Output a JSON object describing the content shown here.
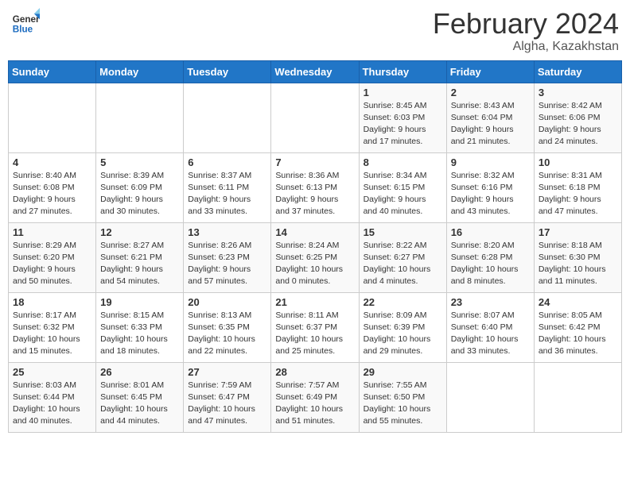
{
  "header": {
    "logo_line1": "General",
    "logo_line2": "Blue",
    "main_title": "February 2024",
    "sub_title": "Algha, Kazakhstan"
  },
  "days_of_week": [
    "Sunday",
    "Monday",
    "Tuesday",
    "Wednesday",
    "Thursday",
    "Friday",
    "Saturday"
  ],
  "weeks": [
    [
      {
        "day": "",
        "info": ""
      },
      {
        "day": "",
        "info": ""
      },
      {
        "day": "",
        "info": ""
      },
      {
        "day": "",
        "info": ""
      },
      {
        "day": "1",
        "info": "Sunrise: 8:45 AM\nSunset: 6:03 PM\nDaylight: 9 hours and 17 minutes."
      },
      {
        "day": "2",
        "info": "Sunrise: 8:43 AM\nSunset: 6:04 PM\nDaylight: 9 hours and 21 minutes."
      },
      {
        "day": "3",
        "info": "Sunrise: 8:42 AM\nSunset: 6:06 PM\nDaylight: 9 hours and 24 minutes."
      }
    ],
    [
      {
        "day": "4",
        "info": "Sunrise: 8:40 AM\nSunset: 6:08 PM\nDaylight: 9 hours and 27 minutes."
      },
      {
        "day": "5",
        "info": "Sunrise: 8:39 AM\nSunset: 6:09 PM\nDaylight: 9 hours and 30 minutes."
      },
      {
        "day": "6",
        "info": "Sunrise: 8:37 AM\nSunset: 6:11 PM\nDaylight: 9 hours and 33 minutes."
      },
      {
        "day": "7",
        "info": "Sunrise: 8:36 AM\nSunset: 6:13 PM\nDaylight: 9 hours and 37 minutes."
      },
      {
        "day": "8",
        "info": "Sunrise: 8:34 AM\nSunset: 6:15 PM\nDaylight: 9 hours and 40 minutes."
      },
      {
        "day": "9",
        "info": "Sunrise: 8:32 AM\nSunset: 6:16 PM\nDaylight: 9 hours and 43 minutes."
      },
      {
        "day": "10",
        "info": "Sunrise: 8:31 AM\nSunset: 6:18 PM\nDaylight: 9 hours and 47 minutes."
      }
    ],
    [
      {
        "day": "11",
        "info": "Sunrise: 8:29 AM\nSunset: 6:20 PM\nDaylight: 9 hours and 50 minutes."
      },
      {
        "day": "12",
        "info": "Sunrise: 8:27 AM\nSunset: 6:21 PM\nDaylight: 9 hours and 54 minutes."
      },
      {
        "day": "13",
        "info": "Sunrise: 8:26 AM\nSunset: 6:23 PM\nDaylight: 9 hours and 57 minutes."
      },
      {
        "day": "14",
        "info": "Sunrise: 8:24 AM\nSunset: 6:25 PM\nDaylight: 10 hours and 0 minutes."
      },
      {
        "day": "15",
        "info": "Sunrise: 8:22 AM\nSunset: 6:27 PM\nDaylight: 10 hours and 4 minutes."
      },
      {
        "day": "16",
        "info": "Sunrise: 8:20 AM\nSunset: 6:28 PM\nDaylight: 10 hours and 8 minutes."
      },
      {
        "day": "17",
        "info": "Sunrise: 8:18 AM\nSunset: 6:30 PM\nDaylight: 10 hours and 11 minutes."
      }
    ],
    [
      {
        "day": "18",
        "info": "Sunrise: 8:17 AM\nSunset: 6:32 PM\nDaylight: 10 hours and 15 minutes."
      },
      {
        "day": "19",
        "info": "Sunrise: 8:15 AM\nSunset: 6:33 PM\nDaylight: 10 hours and 18 minutes."
      },
      {
        "day": "20",
        "info": "Sunrise: 8:13 AM\nSunset: 6:35 PM\nDaylight: 10 hours and 22 minutes."
      },
      {
        "day": "21",
        "info": "Sunrise: 8:11 AM\nSunset: 6:37 PM\nDaylight: 10 hours and 25 minutes."
      },
      {
        "day": "22",
        "info": "Sunrise: 8:09 AM\nSunset: 6:39 PM\nDaylight: 10 hours and 29 minutes."
      },
      {
        "day": "23",
        "info": "Sunrise: 8:07 AM\nSunset: 6:40 PM\nDaylight: 10 hours and 33 minutes."
      },
      {
        "day": "24",
        "info": "Sunrise: 8:05 AM\nSunset: 6:42 PM\nDaylight: 10 hours and 36 minutes."
      }
    ],
    [
      {
        "day": "25",
        "info": "Sunrise: 8:03 AM\nSunset: 6:44 PM\nDaylight: 10 hours and 40 minutes."
      },
      {
        "day": "26",
        "info": "Sunrise: 8:01 AM\nSunset: 6:45 PM\nDaylight: 10 hours and 44 minutes."
      },
      {
        "day": "27",
        "info": "Sunrise: 7:59 AM\nSunset: 6:47 PM\nDaylight: 10 hours and 47 minutes."
      },
      {
        "day": "28",
        "info": "Sunrise: 7:57 AM\nSunset: 6:49 PM\nDaylight: 10 hours and 51 minutes."
      },
      {
        "day": "29",
        "info": "Sunrise: 7:55 AM\nSunset: 6:50 PM\nDaylight: 10 hours and 55 minutes."
      },
      {
        "day": "",
        "info": ""
      },
      {
        "day": "",
        "info": ""
      }
    ]
  ]
}
